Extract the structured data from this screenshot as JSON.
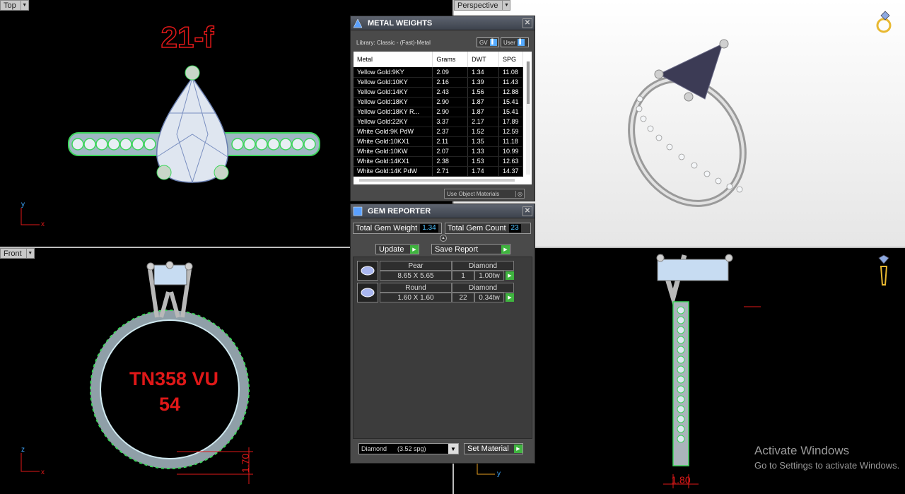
{
  "viewports": {
    "top": {
      "label": "Top",
      "stamp": "21-f",
      "axis_y": "y",
      "axis_x": "x"
    },
    "perspective": {
      "label": "Perspective"
    },
    "front": {
      "label": "Front",
      "engraving_line1": "TN358 VU",
      "engraving_line2": "54",
      "dimension": "1.70",
      "axis_z": "z",
      "axis_x": "x"
    },
    "right": {
      "dimension": "1.80",
      "axis_y": "y"
    }
  },
  "metal_weights": {
    "title": "METAL WEIGHTS",
    "library": "Library: Classic - (Fast)-Metal",
    "toggle_gv": "GV",
    "toggle_user": "User",
    "columns": [
      "Metal",
      "Grams",
      "DWT",
      "SPG"
    ],
    "rows": [
      [
        "Yellow Gold:9KY",
        "2.09",
        "1.34",
        "11.08"
      ],
      [
        "Yellow Gold:10KY",
        "2.16",
        "1.39",
        "11.43"
      ],
      [
        "Yellow Gold:14KY",
        "2.43",
        "1.56",
        "12.88"
      ],
      [
        "Yellow Gold:18KY",
        "2.90",
        "1.87",
        "15.41"
      ],
      [
        "Yellow Gold:18KY R...",
        "2.90",
        "1.87",
        "15.41"
      ],
      [
        "Yellow Gold:22KY",
        "3.37",
        "2.17",
        "17.89"
      ],
      [
        "White Gold:9K PdW",
        "2.37",
        "1.52",
        "12.59"
      ],
      [
        "White Gold:10KX1",
        "2.11",
        "1.35",
        "11.18"
      ],
      [
        "White Gold:10KW",
        "2.07",
        "1.33",
        "10.99"
      ],
      [
        "White Gold:14KX1",
        "2.38",
        "1.53",
        "12.63"
      ],
      [
        "White Gold:14K PdW",
        "2.71",
        "1.74",
        "14.37"
      ]
    ],
    "use_object_materials": "Use Object Materials"
  },
  "gem_reporter": {
    "title": "GEM REPORTER",
    "total_gem_weight_label": "Total Gem Weight",
    "total_gem_weight": "1.34",
    "total_gem_count_label": "Total Gem Count",
    "total_gem_count": "23",
    "update_label": "Update",
    "save_report_label": "Save Report",
    "gems": [
      {
        "shape": "Pear",
        "material": "Diamond",
        "size": "8.65 X 5.65",
        "count": "1",
        "weight": "1.00tw"
      },
      {
        "shape": "Round",
        "material": "Diamond",
        "size": "1.60 X 1.60",
        "count": "22",
        "weight": "0.34tw"
      }
    ],
    "material_select": "Diamond      (3.52 spg)",
    "set_material_label": "Set Material"
  },
  "watermark": {
    "line1": "Activate Windows",
    "line2": "Go to Settings to activate Windows."
  },
  "colors": {
    "annotation_red": "#e01818",
    "prong_green": "#3cd65a",
    "accent_blue": "#4fc3ff",
    "play_green": "#3fb43f"
  }
}
